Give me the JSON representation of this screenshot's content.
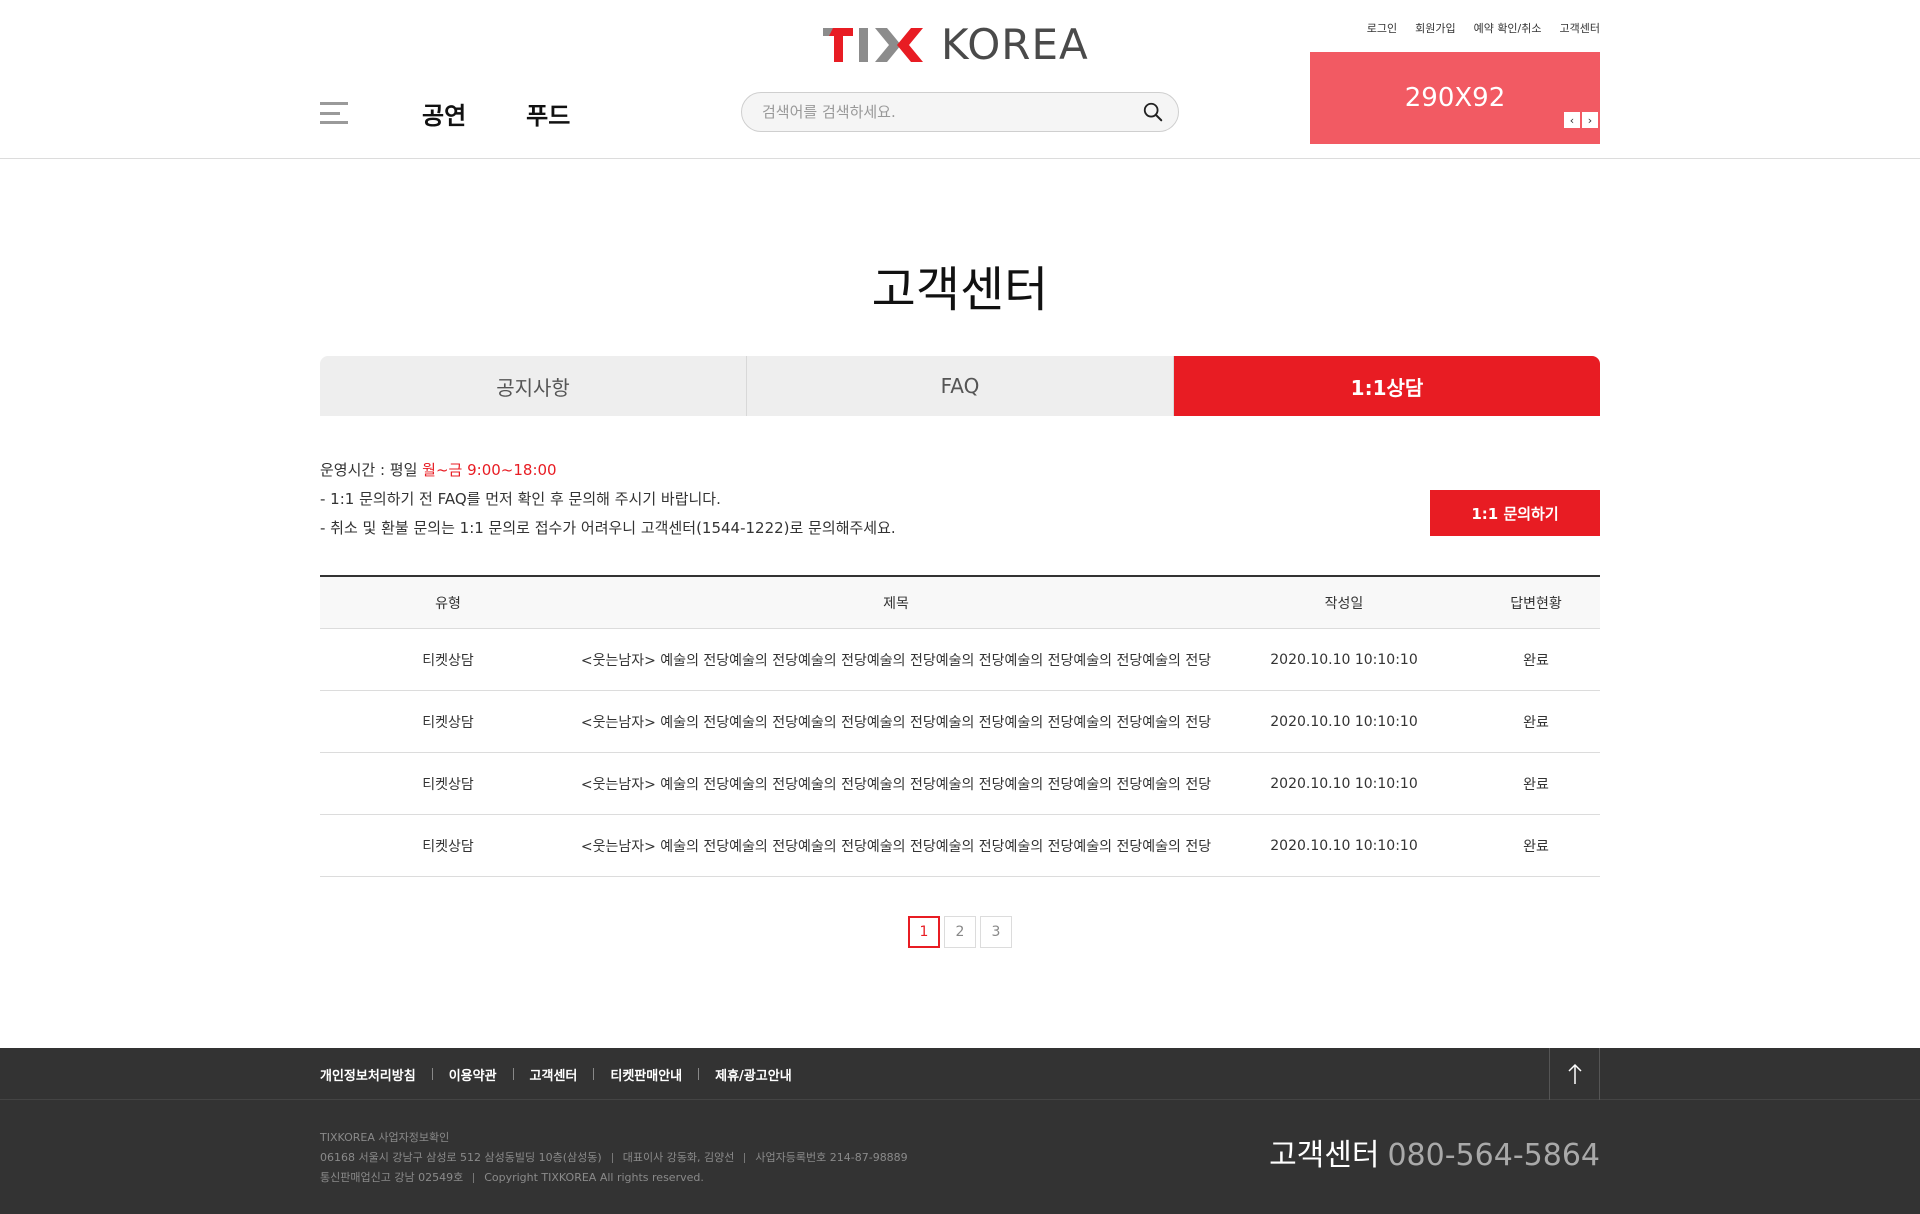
{
  "header": {
    "logo_text": "KOREA",
    "util_links": [
      "로그인",
      "회원가입",
      "예약 확인/취소",
      "고객센터"
    ],
    "nav": [
      "공연",
      "푸드"
    ],
    "search_placeholder": "검색어를 검색하세요.",
    "banner": {
      "text": "290X92",
      "prev": "‹",
      "next": "›"
    }
  },
  "page_title": "고객센터",
  "tabs": [
    {
      "label": "공지사항",
      "active": false
    },
    {
      "label": "FAQ",
      "active": false
    },
    {
      "label": "1:1상담",
      "active": true
    }
  ],
  "info": {
    "hours_label": "운영시간 : 평일 ",
    "hours_value": "월~금 9:00~18:00",
    "line1": "- 1:1 문의하기 전 FAQ를 먼저 확인 후 문의해 주시기 바랍니다.",
    "line2": "- 취소 및 환불 문의는 1:1 문의로 접수가 어려우니 고객센터(1544-1222)로 문의해주세요.",
    "ask_button": "1:1 문의하기"
  },
  "table": {
    "headers": [
      "유형",
      "제목",
      "작성일",
      "답변현황"
    ],
    "rows": [
      [
        "티켓상담",
        "<웃는남자> 예술의 전당예술의 전당예술의 전당예술의 전당예술의 전당예술의 전당예술의 전당예술의 전당",
        "2020.10.10 10:10:10",
        "완료"
      ],
      [
        "티켓상담",
        "<웃는남자> 예술의 전당예술의 전당예술의 전당예술의 전당예술의 전당예술의 전당예술의 전당예술의 전당",
        "2020.10.10 10:10:10",
        "완료"
      ],
      [
        "티켓상담",
        "<웃는남자> 예술의 전당예술의 전당예술의 전당예술의 전당예술의 전당예술의 전당예술의 전당예술의 전당",
        "2020.10.10 10:10:10",
        "완료"
      ],
      [
        "티켓상담",
        "<웃는남자> 예술의 전당예술의 전당예술의 전당예술의 전당예술의 전당예술의 전당예술의 전당예술의 전당",
        "2020.10.10 10:10:10",
        "완료"
      ]
    ]
  },
  "pagination": {
    "pages": [
      "1",
      "2",
      "3"
    ],
    "current": "1"
  },
  "footer": {
    "links": [
      "개인정보처리방침",
      "이용약관",
      "고객센터",
      "티켓판매안내",
      "제휴/광고안내"
    ],
    "company_title": "TIXKOREA 사업자정보확인",
    "address": "06168 서울시 강남구 삼성로 512 삼성동빌딩 10층(삼성동)",
    "ceo": "대표이사 강동화, 김양선",
    "biz_no": "사업자등록번호 214-87-98889",
    "mail_order": "통신판매업신고 강남 02549호",
    "copyright": "Copyright TIXKOREA All rights reserved.",
    "cs_label": "고객센터",
    "cs_phone": "080-564-5864"
  },
  "colors": {
    "brand_red": "#e81c23",
    "banner": "#f25a63",
    "footer_bg": "#333333"
  }
}
